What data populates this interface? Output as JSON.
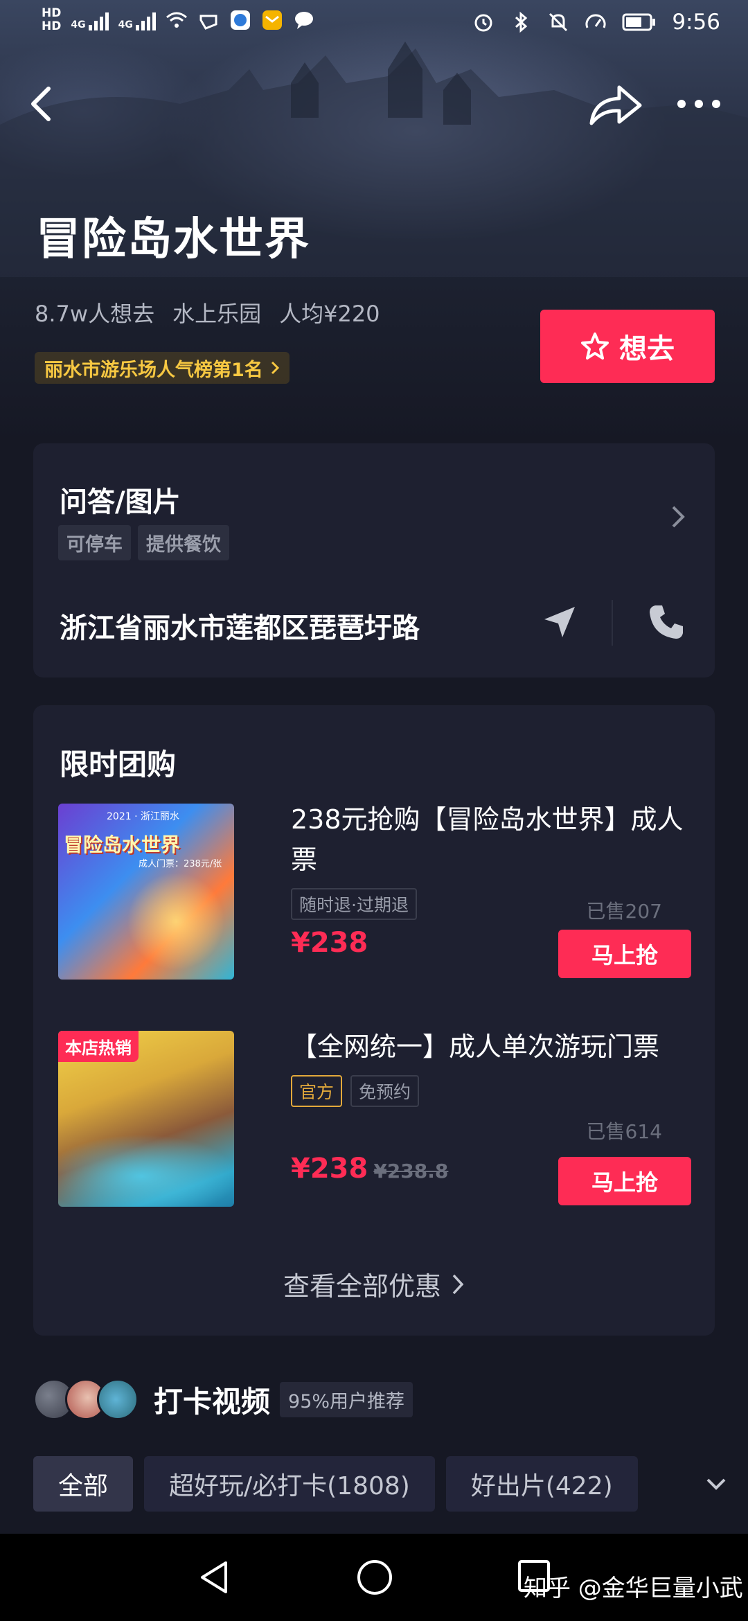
{
  "status_bar": {
    "hd1": "HD",
    "hd2": "HD",
    "net1": "4G",
    "net2": "4G",
    "time": "9:56"
  },
  "place": {
    "title": "冒险岛水世界",
    "want_count": "8.7w人想去",
    "category": "水上乐园",
    "avg_price": "人均¥220",
    "rank_badge": "丽水市游乐场人气榜第1名",
    "want_button": "想去"
  },
  "info_card": {
    "section_title": "问答/图片",
    "tags": [
      "可停车",
      "提供餐饮"
    ],
    "address": "浙江省丽水市莲都区琵琶圩路"
  },
  "group_buy": {
    "title": "限时团购",
    "deals": [
      {
        "name": "238元抢购【冒险岛水世界】成人票",
        "tags": [
          "随时退·过期退"
        ],
        "sold": "已售207",
        "price": "¥238",
        "old_price": "",
        "button": "马上抢",
        "thumb_caption": "冒险岛水世界",
        "thumb_year": "2021 · 浙江丽水",
        "thumb_price": "成人门票：238元/张"
      },
      {
        "name": "【全网统一】成人单次游玩门票",
        "tags": [
          "官方",
          "免预约"
        ],
        "sold": "已售614",
        "price": "¥238",
        "old_price": "¥238.8",
        "button": "马上抢",
        "badge": "本店热销"
      }
    ],
    "see_all": "查看全部优惠"
  },
  "checkin": {
    "title": "打卡视频",
    "recommend": "95%用户推荐",
    "filters": [
      "全部",
      "超好玩/必打卡(1808)",
      "好出片(422)"
    ]
  },
  "watermark": "知乎 @金华巨量小武",
  "colors": {
    "accent": "#fe2c55",
    "gold": "#f7c842",
    "background": "#161824",
    "card": "#1e2030"
  }
}
